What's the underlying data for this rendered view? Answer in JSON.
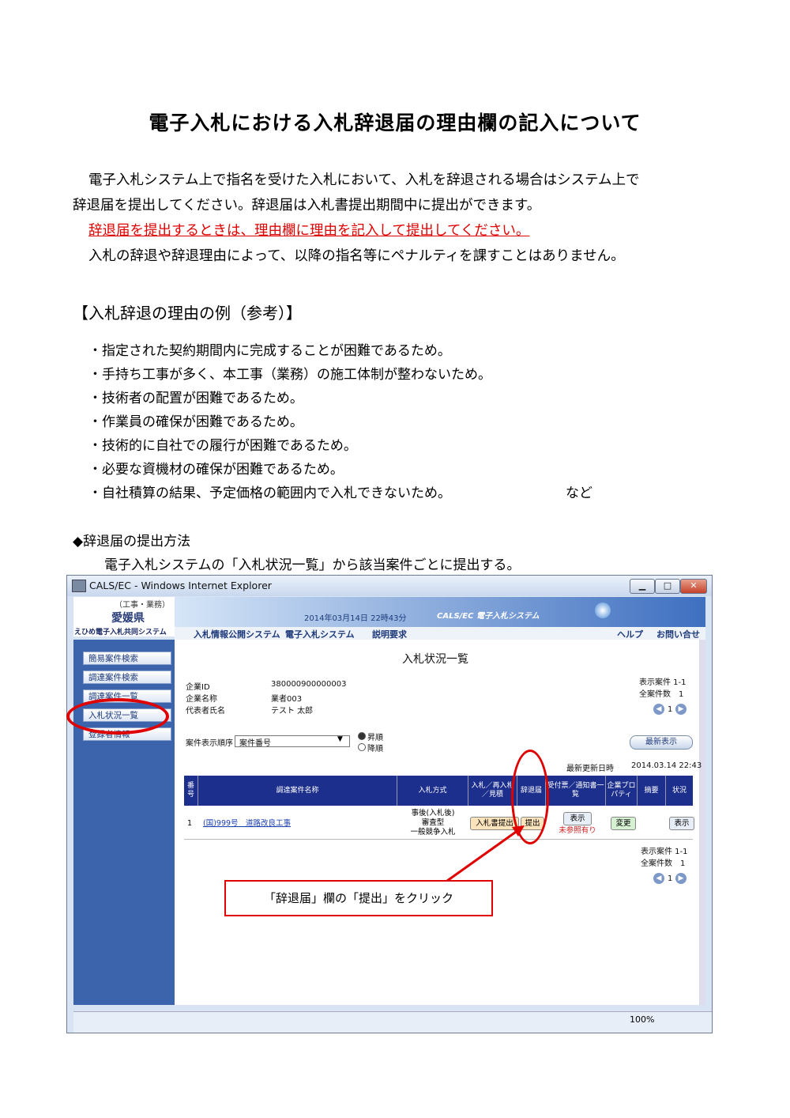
{
  "title": "電子入札における入札辞退届の理由欄の記入について",
  "intro": {
    "line1": "電子入札システム上で指名を受けた入札において、入札を辞退される場合はシステム上で",
    "line2": "辞退届を提出してください。辞退届は入札書提出期間中に提出ができます。",
    "line3_red": "辞退届を提出するときは、理由欄に理由を記入して提出してください。",
    "line4": "入札の辞退や辞退理由によって、以降の指名等にペナルティを課すことはありません。"
  },
  "section_heading": "【入札辞退の理由の例（参考）】",
  "reasons": [
    "・指定された契約期間内に完成することが困難であるため。",
    "・手持ち工事が多く、本工事（業務）の施工体制が整わないため。",
    "・技術者の配置が困難であるため。",
    "・作業員の確保が困難であるため。",
    "・技術的に自社での履行が困難であるため。",
    "・必要な資機材の確保が困難であるため。",
    "・自社積算の結果、予定価格の範囲内で入札できないため。"
  ],
  "reasons_suffix": "など",
  "method": {
    "heading": "◆辞退届の提出方法",
    "text": "電子入札システムの「入札状況一覧」から該当案件ごとに提出する。"
  },
  "screenshot": {
    "window_title": "CALS/EC - Windows Internet Explorer",
    "window_buttons": {
      "minimize": "▁",
      "maximize": "□",
      "close": "✕"
    },
    "logo": {
      "sub": "（工事・業務）",
      "pref": "愛媛県",
      "system": "えひめ電子入札共同システム"
    },
    "banner": {
      "datetime": "2014年03月14日 22時43分",
      "system": "CALS/EC 電子入札システム"
    },
    "nav": [
      "入札情報公開システム",
      "電子入札システム",
      "説明要求"
    ],
    "nav_right": [
      "ヘルプ",
      "お問い合せ"
    ],
    "sidebar": [
      "簡易案件検索",
      "調達案件検索",
      "調達案件一覧",
      "入札状況一覧",
      "登録者情報"
    ],
    "page_heading": "入札状況一覧",
    "company": {
      "labels": [
        "企業ID",
        "企業名称",
        "代表者氏名"
      ],
      "values": [
        "380000900000003",
        "業者003",
        "テスト 太郎"
      ]
    },
    "counts_top": {
      "shown": "表示案件 1-1",
      "total": "全案件数　1"
    },
    "pager_page": "1",
    "sort": {
      "label": "案件表示順序",
      "value": "案件番号",
      "asc": "昇順",
      "desc": "降順"
    },
    "refresh_button": "最新表示",
    "last_update": {
      "label": "最新更新日時",
      "value": "2014.03.14 22:43"
    },
    "table": {
      "headers": [
        "番号",
        "調達案件名称",
        "入札方式",
        "入札／再入札／見積",
        "辞退届",
        "受付票／通知書一覧",
        "企業プロパティ",
        "摘要",
        "状況"
      ],
      "row": {
        "no": "1",
        "name": "(国)999号　道路改良工事",
        "method": [
          "事後(入札後)",
          "審査型",
          "一般競争入札"
        ],
        "bid_button": "入札書提出",
        "decline_button": "提出",
        "notice_button": "表示",
        "notice_status": "未参照有り",
        "property_button": "変更",
        "status_button": "表示"
      }
    },
    "counts_bottom": {
      "shown": "表示案件 1-1",
      "total": "全案件数　1"
    },
    "zoom": "100%"
  },
  "callout": "「辞退届」欄の「提出」をクリック"
}
